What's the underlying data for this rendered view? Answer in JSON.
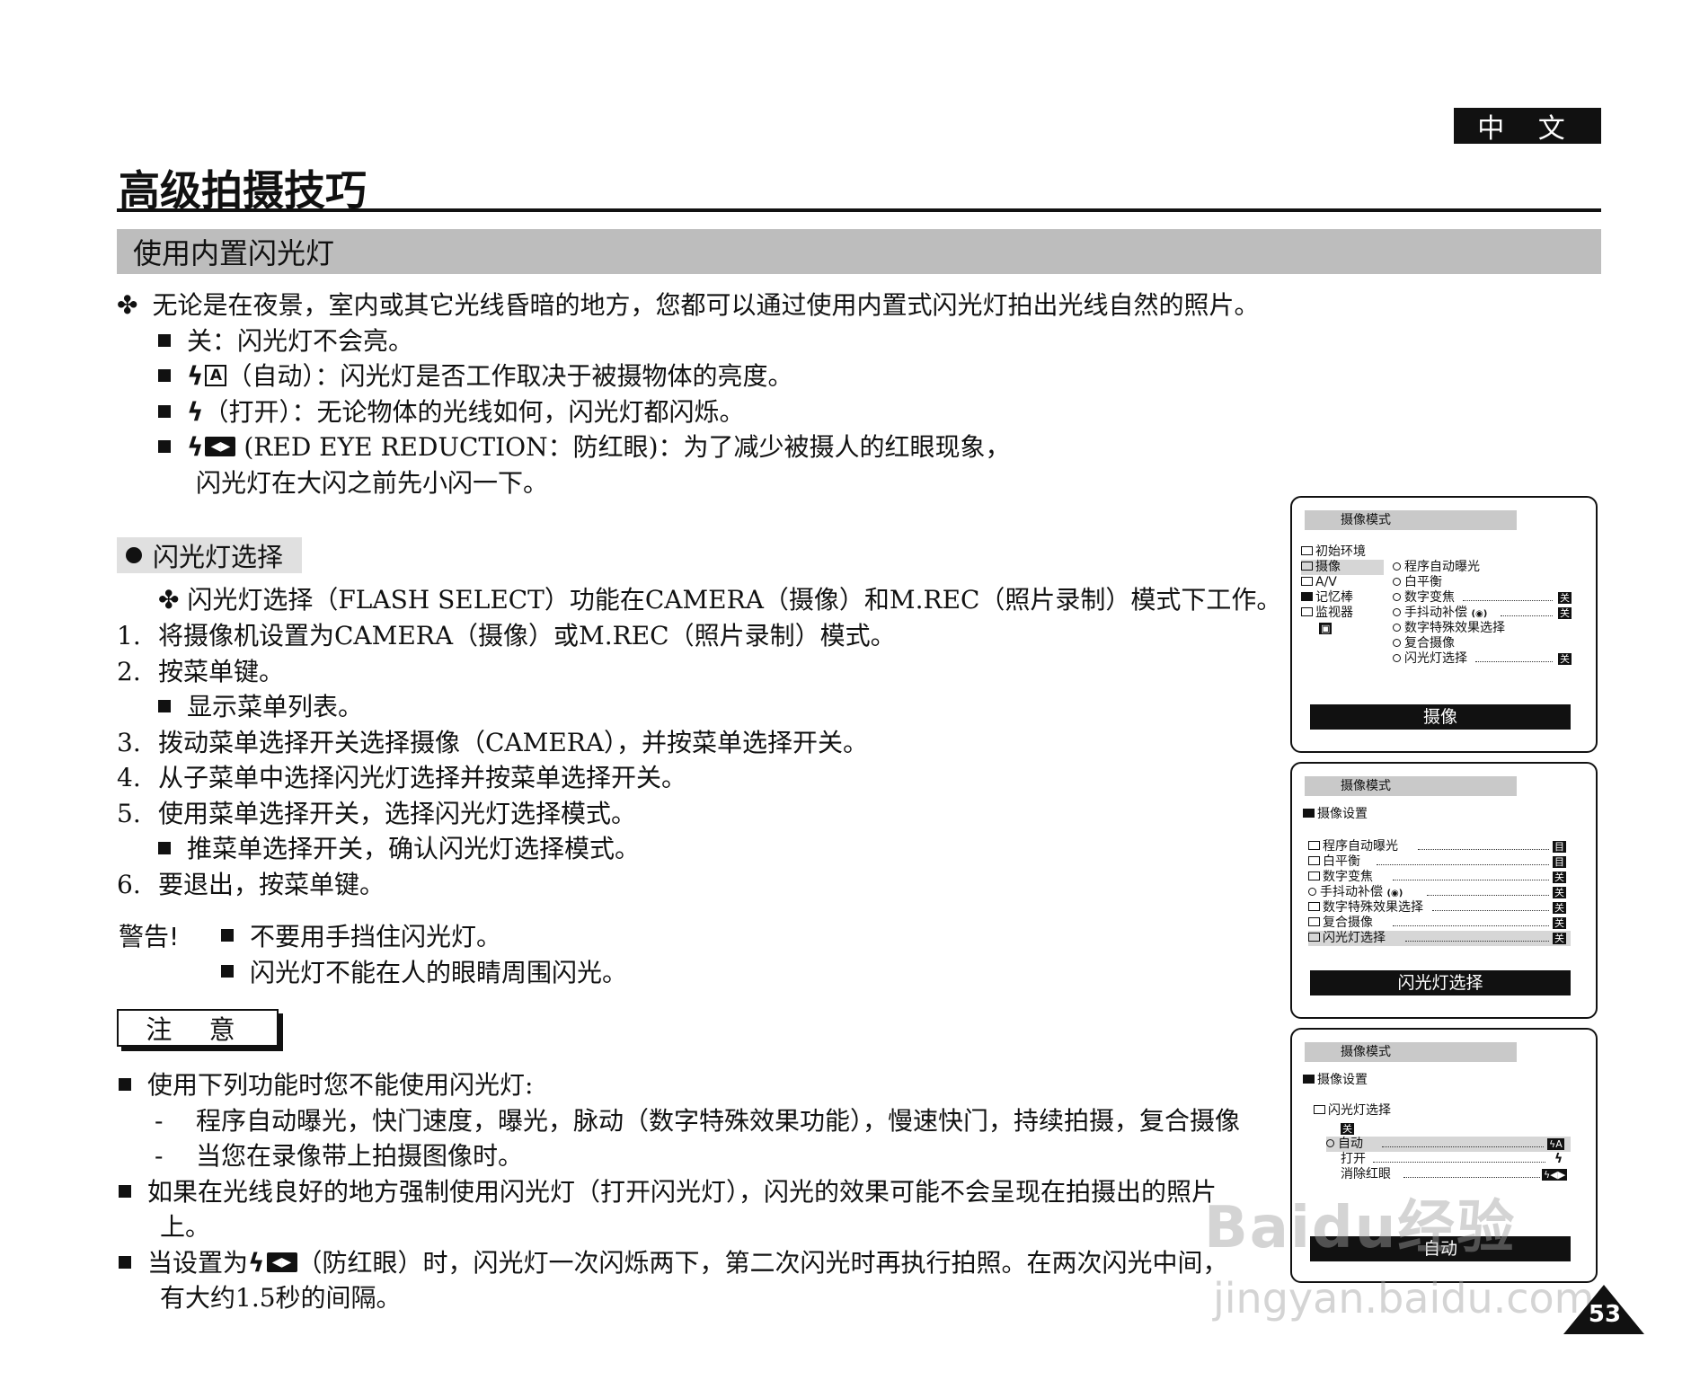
{
  "lang_tab": "中 文",
  "page_title": "高级拍摄技巧",
  "section_title": "使用内置闪光灯",
  "intro": {
    "bullet": "✤",
    "text": "无论是在夜景，室内或其它光线昏暗的地方，您都可以通过使用内置式闪光灯拍出光线自然的照片。",
    "items": [
      {
        "text": "关：闪光灯不会亮。"
      },
      {
        "icon": "ϟ",
        "icon_box": "A",
        "text": "（自动）：闪光灯是否工作取决于被摄物体的亮度。"
      },
      {
        "icon": "ϟ",
        "text": "（打开）：无论物体的光线如何，闪光灯都闪烁。"
      },
      {
        "icon": "ϟ",
        "icon_box": "◀▶",
        "text": " (RED EYE REDUCTION：防红眼)：为了减少被摄人的红眼现象，",
        "text2": "闪光灯在大闪之前先小闪一下。"
      }
    ]
  },
  "flash_select": {
    "header": "闪光灯选择",
    "note": "✤ 闪光灯选择（FLASH SELECT）功能在CAMERA（摄像）和M.REC（照片录制）模式下工作。",
    "steps": [
      {
        "num": "1.",
        "text": "将摄像机设置为CAMERA（摄像）或M.REC（照片录制）模式。"
      },
      {
        "num": "2.",
        "text": "按菜单键。"
      },
      {
        "sub": "显示菜单列表。"
      },
      {
        "num": "3.",
        "text": "拨动菜单选择开关选择摄像（CAMERA），并按菜单选择开关。"
      },
      {
        "num": "4.",
        "text": "从子菜单中选择闪光灯选择并按菜单选择开关。"
      },
      {
        "num": "5.",
        "text": "使用菜单选择开关，选择闪光灯选择模式。"
      },
      {
        "sub": "推菜单选择开关，确认闪光灯选择模式。"
      },
      {
        "num": "6.",
        "text": "要退出，按菜单键。"
      }
    ]
  },
  "warning": {
    "label": "警告!",
    "items": [
      "不要用手挡住闪光灯。",
      "闪光灯不能在人的眼睛周围闪光。"
    ]
  },
  "note": {
    "label": "注 意",
    "items": [
      {
        "text": "使用下列功能时您不能使用闪光灯:"
      },
      {
        "dash": "程序自动曝光，快门速度，曝光，脉动（数字特殊效果功能），慢速快门，持续拍摄，复合摄像"
      },
      {
        "dash": "当您在录像带上拍摄图像时。"
      },
      {
        "text": "如果在光线良好的地方强制使用闪光灯（打开闪光灯），闪光的效果可能不会呈现在拍摄出的照片",
        "text2": "上。"
      },
      {
        "pre": "当设置为",
        "icon": "ϟ",
        "icon_box": "◀▶",
        "text": "（防红眼）时，闪光灯一次闪烁两下，第二次闪光时再执行拍照。在两次闪光中间，",
        "text2": "有大约1.5秒的间隔。"
      }
    ]
  },
  "screen1": {
    "title": "摄像模式",
    "left_menu": [
      "初始环境",
      "摄像",
      "A/V",
      "记忆棒",
      "监视器"
    ],
    "right_menu": [
      "程序自动曝光",
      "白平衡",
      "数字变焦",
      "手抖动补偿",
      "数字特殊效果选择",
      "复合摄像",
      "闪光灯选择"
    ],
    "values": {
      "digital_zoom": "关",
      "dis": "关",
      "flash": "关"
    },
    "dis_icon": "(◉)",
    "bottom": "摄像"
  },
  "screen2": {
    "title": "摄像模式",
    "folder": "摄像设置",
    "items": [
      {
        "label": "程序自动曝光",
        "val": "目"
      },
      {
        "label": "白平衡",
        "val": "目"
      },
      {
        "label": "数字变焦",
        "val": "关"
      },
      {
        "label": "手抖动补偿",
        "val": "关",
        "icon": "(◉)"
      },
      {
        "label": "数字特殊效果选择",
        "val": "关"
      },
      {
        "label": "复合摄像",
        "val": "关"
      },
      {
        "label": "闪光灯选择",
        "val": "关"
      }
    ],
    "bottom": "闪光灯选择"
  },
  "screen3": {
    "title": "摄像模式",
    "folder": "摄像设置",
    "sub_folder": "闪光灯选择",
    "options": [
      {
        "label": "关"
      },
      {
        "label": "自动",
        "val": "ϟA"
      },
      {
        "label": "打开",
        "val": "ϟ"
      },
      {
        "label": "消除红眼",
        "val": "ϟ◀▶"
      }
    ],
    "bottom": "自动"
  },
  "watermark": "Baidu经验",
  "watermark_url": "jingyan.baidu.com",
  "page_number": "53"
}
